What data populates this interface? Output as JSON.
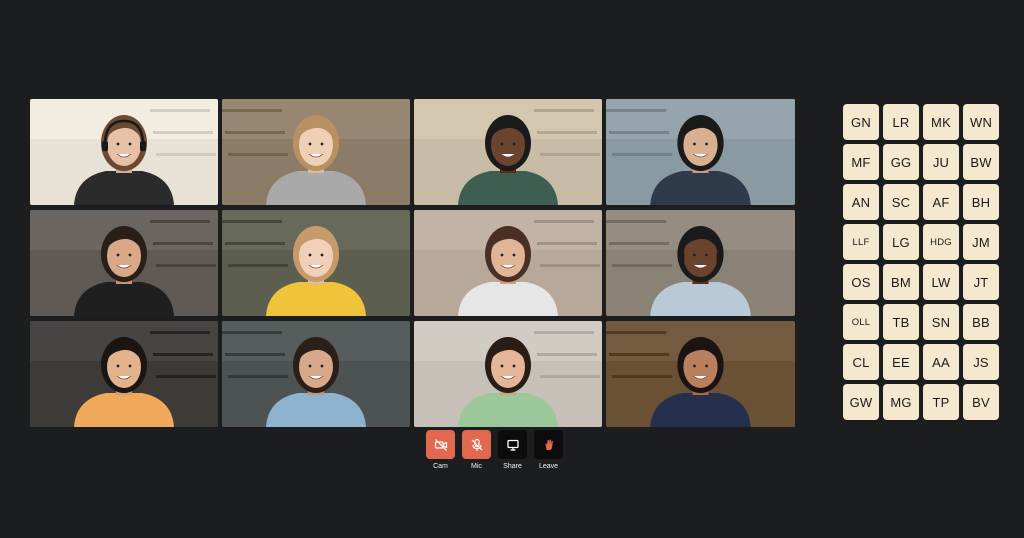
{
  "colors": {
    "background": "#1b1d1e",
    "control_red": "#e2694f",
    "control_dark": "#0c0c0c",
    "chip_bg": "#f4e8cf"
  },
  "video_tiles": [
    {
      "name": "presenter-with-headset-bookshelf",
      "bg": "#e8e2d6",
      "shirt": "#2b2b2b",
      "skin": "#e7c1a6",
      "hair": "#6a4a33",
      "headset": true
    },
    {
      "name": "woman-long-blonde-hair-kitchen",
      "bg": "#8c7b66",
      "shirt": "#a9a9a9",
      "skin": "#efcfb6",
      "hair": "#b99063",
      "headset": false
    },
    {
      "name": "man-glasses-beard-office",
      "bg": "#c9bca6",
      "shirt": "#3f5e52",
      "skin": "#6b4430",
      "hair": "#1b1b1b",
      "headset": false
    },
    {
      "name": "man-glasses-office-windows",
      "bg": "#8a9aa2",
      "shirt": "#2f3a4b",
      "skin": "#d8b08f",
      "hair": "#1a1a1a",
      "headset": false
    },
    {
      "name": "woman-dark-hair-home",
      "bg": "#5f5a55",
      "shirt": "#1f1f1f",
      "skin": "#d9a888",
      "hair": "#2a1e18",
      "headset": false
    },
    {
      "name": "woman-yellow-sweater-library",
      "bg": "#5c5f4f",
      "shirt": "#f0c43a",
      "skin": "#f1cfb8",
      "hair": "#c79a6c",
      "headset": false
    },
    {
      "name": "woman-white-blouse-plants",
      "bg": "#b8a89a",
      "shirt": "#e6e6e6",
      "skin": "#e0b497",
      "hair": "#4a3024",
      "headset": false
    },
    {
      "name": "man-headset-office",
      "bg": "#8b8277",
      "shirt": "#b9c9d8",
      "skin": "#6a432e",
      "hair": "#1b1b1b",
      "headset": true
    },
    {
      "name": "young-man-orange-shirt",
      "bg": "#3d3b38",
      "shirt": "#f0a95a",
      "skin": "#e3b38e",
      "hair": "#1a1614",
      "headset": false
    },
    {
      "name": "man-blue-shirt-bookshelf",
      "bg": "#4d5252",
      "shirt": "#8fb2cf",
      "skin": "#d8a88a",
      "hair": "#2b1f19",
      "headset": false
    },
    {
      "name": "woman-green-top-smiling",
      "bg": "#c7c0b8",
      "shirt": "#9cc79a",
      "skin": "#e4b699",
      "hair": "#2a1d16",
      "headset": false
    },
    {
      "name": "woman-navy-top-bookshelf",
      "bg": "#6a5136",
      "shirt": "#24304d",
      "skin": "#b9805e",
      "hair": "#1b1412",
      "headset": false
    }
  ],
  "controls": [
    {
      "label": "Cam",
      "icon": "camera-off-icon",
      "style": "red"
    },
    {
      "label": "Mic",
      "icon": "mic-off-icon",
      "style": "red"
    },
    {
      "label": "Share",
      "icon": "share-screen-icon",
      "style": "dark"
    },
    {
      "label": "Leave",
      "icon": "leave-icon",
      "style": "dark"
    }
  ],
  "participants": [
    "GN",
    "LR",
    "MK",
    "WN",
    "MF",
    "GG",
    "JU",
    "BW",
    "AN",
    "SC",
    "AF",
    "BH",
    "LLF",
    "LG",
    "HDG",
    "JM",
    "OS",
    "BM",
    "LW",
    "JT",
    "OLL",
    "TB",
    "SN",
    "BB",
    "CL",
    "EE",
    "AA",
    "JS",
    "GW",
    "MG",
    "TP",
    "BV"
  ]
}
